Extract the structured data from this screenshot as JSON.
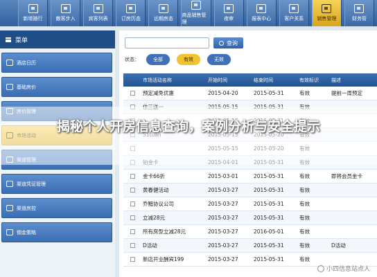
{
  "toolbar": {
    "buttons": [
      {
        "label": "新增随行",
        "icon": "grid-icon"
      },
      {
        "label": "散客步入",
        "icon": "person-icon"
      },
      {
        "label": "宾客列表",
        "icon": "list-icon"
      },
      {
        "label": "订房历态",
        "icon": "home-icon"
      },
      {
        "label": "远期房态",
        "icon": "calendar-icon"
      },
      {
        "label": "商品销售管理",
        "icon": "cart-icon"
      },
      {
        "label": "夜审",
        "icon": "monitor-icon"
      },
      {
        "label": "报表中心",
        "icon": "chart-icon"
      },
      {
        "label": "客户关系",
        "icon": "contacts-icon"
      },
      {
        "label": "销售管理",
        "icon": "sales-icon",
        "active": true
      },
      {
        "label": "财务管",
        "icon": "finance-icon"
      }
    ]
  },
  "sidebar": {
    "header": "菜单",
    "items": [
      {
        "label": "酒店日历"
      },
      {
        "label": "基础房价"
      },
      {
        "label": "房价管理"
      },
      {
        "label": "市场活动",
        "active": true
      },
      {
        "label": "渠道管理"
      },
      {
        "label": "渠道凭证管理"
      },
      {
        "label": "渠道房控"
      },
      {
        "label": "佣金策略"
      }
    ]
  },
  "search": {
    "placeholder": "",
    "button_label": "查询"
  },
  "filter": {
    "label": "状态：",
    "all": "全部",
    "on": "有效",
    "off": "无效"
  },
  "table": {
    "headers": [
      "市场活动名称",
      "开始时间",
      "结束时间",
      "有效标识",
      "描述"
    ],
    "rows": [
      [
        "预定减免优惠",
        "2015-04-20",
        "2015-05-31",
        "有效",
        "提前一周预定"
      ],
      [
        "住三送一",
        "2015-05-15",
        "2015-05-31",
        "有效",
        ""
      ],
      [
        "",
        "2015-05-15",
        "2015-05-31",
        "有效",
        ""
      ],
      [
        "51tuan",
        "2015-05-15",
        "2015-05-20",
        "有效",
        ""
      ],
      [
        "",
        "2015-05-15",
        "2015-05-20",
        "有效",
        ""
      ],
      [
        "铂金卡",
        "2015-04-01",
        "2015-05-31",
        "有效",
        ""
      ],
      [
        "金卡66折",
        "2015-03-01",
        "2015-05-31",
        "有效",
        "即将会员金卡"
      ],
      [
        "黄春健活动",
        "2015-03-27",
        "2015-05-31",
        "有效",
        ""
      ],
      [
        "乔黯协议公司",
        "2015-03-27",
        "2015-05-31",
        "有效",
        ""
      ],
      [
        "立减28元",
        "2015-03-27",
        "2015-05-31",
        "有效",
        ""
      ],
      [
        "所有房型立减28元",
        "2015-03-27",
        "2016-05-01",
        "有效",
        ""
      ],
      [
        "D活动",
        "2015-03-27",
        "2015-05-31",
        "有效",
        "D活动"
      ],
      [
        "新店开业酬宾199",
        "2015-03-27",
        "2015-05-31",
        "有效",
        ""
      ]
    ]
  },
  "overlay": {
    "title": "揭秘个人开房信息查询，案例分析与安全提示"
  },
  "watermark": {
    "text": "小四信息站点人"
  },
  "colors": {
    "primary": "#2f5f9f",
    "accent": "#f1c232"
  }
}
